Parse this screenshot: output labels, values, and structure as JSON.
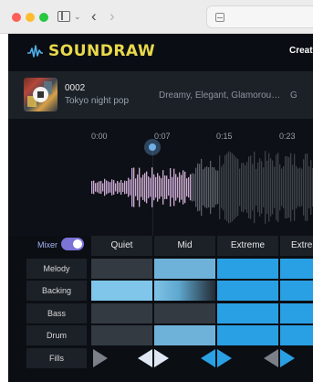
{
  "browser": {
    "icons": [
      "sidebar-icon",
      "chevron-down-icon",
      "back-icon",
      "forward-icon",
      "page-icon"
    ],
    "back_glyph": "‹",
    "forward_glyph": "›",
    "chevron_glyph": "⌄"
  },
  "header": {
    "brand": "SOUNDRAW",
    "create_label": "Create",
    "brand_color": "#e9d84b"
  },
  "track": {
    "id": "0002",
    "name": "Tokyo night pop",
    "tags": "Dreamy, Elegant, Glamorou…",
    "genre": "G"
  },
  "timeline": {
    "time_labels": [
      "0:00",
      "0:07",
      "0:15",
      "0:23"
    ],
    "playhead_time": "0:07"
  },
  "mixer": {
    "label": "Mixer",
    "enabled": true,
    "columns": [
      "Quiet",
      "Mid",
      "Extreme",
      "Extreme"
    ],
    "rows": [
      {
        "label": "Melody",
        "cells": [
          "dark",
          "light",
          "blue",
          "blue"
        ]
      },
      {
        "label": "Backing",
        "cells": [
          "pale",
          "fade",
          "blue",
          "blue"
        ]
      },
      {
        "label": "Bass",
        "cells": [
          "dark",
          "dark",
          "blue",
          "blue"
        ]
      },
      {
        "label": "Drum",
        "cells": [
          "dark",
          "light",
          "blue",
          "blue"
        ]
      }
    ],
    "fills_label": "Fills",
    "colors": {
      "accent": "#2aa0e4",
      "toggle": "#7b73d6"
    }
  }
}
